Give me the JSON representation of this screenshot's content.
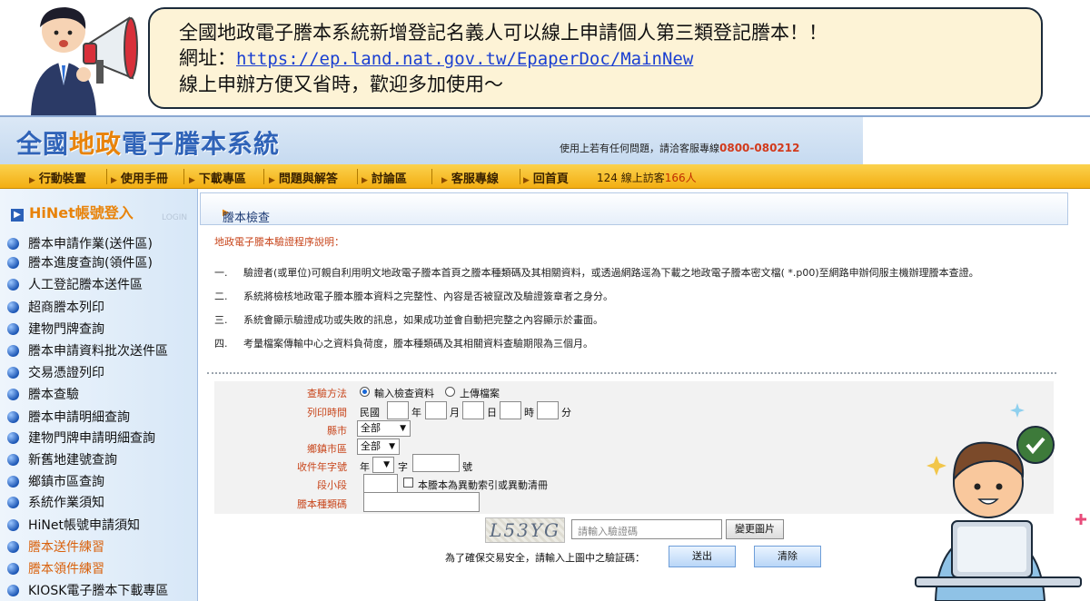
{
  "banner": {
    "line1": "全國地政電子謄本系統新增登記名義人可以線上申請個人第三類登記謄本！！",
    "url_label": "網址：",
    "url": "https://ep.land.nat.gov.tw/EpaperDoc/MainNew",
    "line3": "線上申辦方便又省時，歡迎多加使用～"
  },
  "header": {
    "logo_a": "全國",
    "logo_b": "地政",
    "logo_c": "電子謄本系統",
    "contact_text": "使用上若有任何問題，請洽客服專線",
    "contact_phone": "0800-080212"
  },
  "nav": {
    "items": [
      "行動裝置",
      "使用手冊",
      "下載專區",
      "問題與解答",
      "討論區",
      "客服專線",
      "回首頁"
    ],
    "visitor_count": "124",
    "visitor_text": "線上訪客",
    "visitor_unit": "166人"
  },
  "sidebar": {
    "login": "HiNet帳號登入",
    "login_ghost": "LOGIN",
    "items": [
      "謄本申請作業(送件區)",
      "謄本進度查詢(領件區)",
      "人工登記謄本送件區",
      "超商謄本列印",
      "建物門牌查詢",
      "謄本申請資料批次送件區",
      "交易憑證列印",
      "謄本查驗",
      "謄本申請明細查詢",
      "建物門牌申請明細查詢",
      "新舊地建號查詢",
      "鄉鎮市區查詢",
      "系統作業須知",
      "HiNet帳號申請須知",
      "謄本送件練習",
      "謄本領件練習",
      "KIOSK電子謄本下載專區"
    ]
  },
  "main": {
    "tab": "謄本檢查",
    "intro_title": "地政電子謄本驗證程序說明：",
    "steps": [
      {
        "n": "一.",
        "text": "驗證者(或單位)可親自利用明文地政電子謄本首頁之謄本種類碼及其相關資料，或透過網路逕為下載之地政電子謄本密文檔( *.p00)至網路申辦伺服主機辦理謄本查證。"
      },
      {
        "n": "二.",
        "text": "系統將檢核地政電子謄本謄本資料之完整性、內容是否被竄改及驗證簽章者之身分。"
      },
      {
        "n": "三.",
        "text": "系統會顯示驗證成功或失敗的訊息，如果成功並會自動把完整之內容顯示於畫面。"
      },
      {
        "n": "四.",
        "text": "考量檔案傳輸中心之資料負荷度，謄本種類碼及其相關資料查驗期限為三個月。"
      }
    ]
  },
  "form": {
    "method_label": "查驗方法",
    "method_opt1": "輸入檢查資料",
    "method_opt2": "上傳檔案",
    "print_time_label": "列印時間",
    "roc": "民國",
    "year": "年",
    "month": "月",
    "day": "日",
    "hour": "時",
    "minute": "分",
    "county_label": "縣市",
    "county_value": "全部",
    "town_label": "鄉鎮市區",
    "town_value": "全部",
    "doc_no_label": "收件年字號",
    "doc_year": "年",
    "doc_char": "字",
    "doc_no": "號",
    "section_label": "段小段",
    "cross_check": "本謄本為異動索引或異動清冊",
    "type_code_label": "謄本種類碼",
    "captcha_text": "L53YG",
    "captcha_placeholder": "請輸入驗證碼",
    "change_image": "變更圖片",
    "captcha_hint": "為了確保交易安全，請輸入上圖中之驗証碼：",
    "submit": "送出",
    "clear": "清除"
  }
}
